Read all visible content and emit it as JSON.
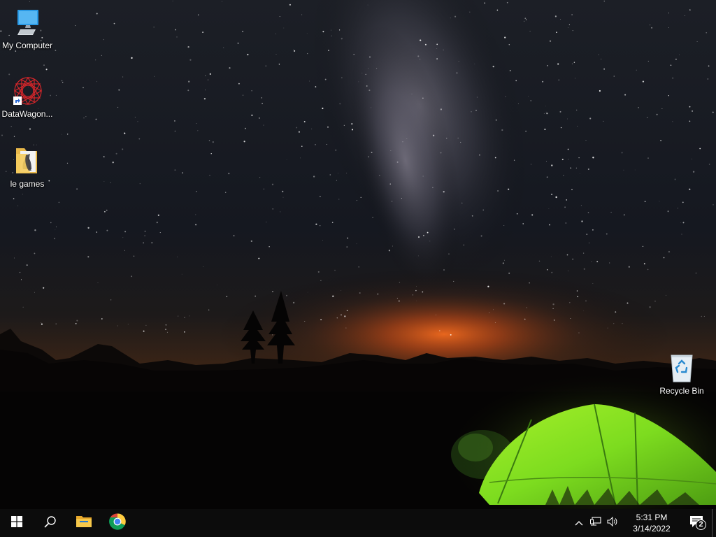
{
  "desktop": {
    "icons": [
      {
        "label": "My Computer",
        "icon": "computer-icon"
      },
      {
        "label": "DataWagon...",
        "icon": "datawagon-shortcut-icon"
      },
      {
        "label": "le games",
        "icon": "folder-icon"
      },
      {
        "label": "Recycle Bin",
        "icon": "recycle-bin-icon"
      }
    ]
  },
  "taskbar": {
    "start_icon": "windows-logo-icon",
    "search_icon": "search-icon",
    "pinned": [
      {
        "icon": "file-explorer-icon"
      },
      {
        "icon": "chrome-icon"
      }
    ],
    "tray": {
      "icons": [
        "chevron-up-icon",
        "network-icon",
        "volume-icon"
      ],
      "time": "5:31 PM",
      "date": "3/14/2022",
      "notification_count": "2"
    }
  },
  "colors": {
    "taskbar_bg": "#0c0c0c",
    "tent_green": "#7ddc1f",
    "horizon_glow": "#e8601a",
    "sky_top": "#1a1d24"
  }
}
